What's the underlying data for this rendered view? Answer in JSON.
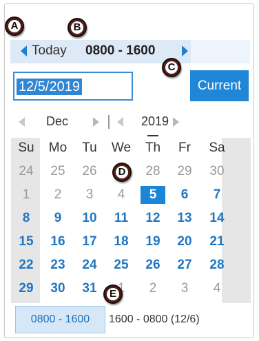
{
  "callouts": [
    "A",
    "B",
    "C",
    "D",
    "E"
  ],
  "shift_nav": {
    "prev_icon": "triangle-left-icon",
    "next_icon": "triangle-right-icon",
    "today_label": "Today",
    "range": "0800 - 1600"
  },
  "date_input": {
    "value": "12/5/2019"
  },
  "current_button": {
    "label": "Current"
  },
  "month_nav": {
    "month": "Dec",
    "year": "2019",
    "separator": "|"
  },
  "weekdays": [
    "Su",
    "Mo",
    "Tu",
    "We",
    "Th",
    "Fr",
    "Sa"
  ],
  "weeks": [
    [
      "24",
      "25",
      "26",
      "27",
      "28",
      "29",
      "30"
    ],
    [
      "1",
      "2",
      "3",
      "4",
      "5",
      "6",
      "7"
    ],
    [
      "8",
      "9",
      "10",
      "11",
      "12",
      "13",
      "14"
    ],
    [
      "15",
      "16",
      "17",
      "18",
      "19",
      "20",
      "21"
    ],
    [
      "22",
      "23",
      "24",
      "25",
      "26",
      "27",
      "28"
    ],
    [
      "29",
      "30",
      "31",
      "1",
      "2",
      "3",
      "4"
    ]
  ],
  "selected_day": "5",
  "today_weekday": "Th",
  "shifts": [
    {
      "label": "0800 - 1600",
      "selected": true
    },
    {
      "label": "1600 - 0800 (12/6)",
      "selected": false
    }
  ],
  "colors": {
    "accent": "#1f86d8",
    "shift_bar": "#dde9f6",
    "callout_ring": "#5a1a12"
  }
}
